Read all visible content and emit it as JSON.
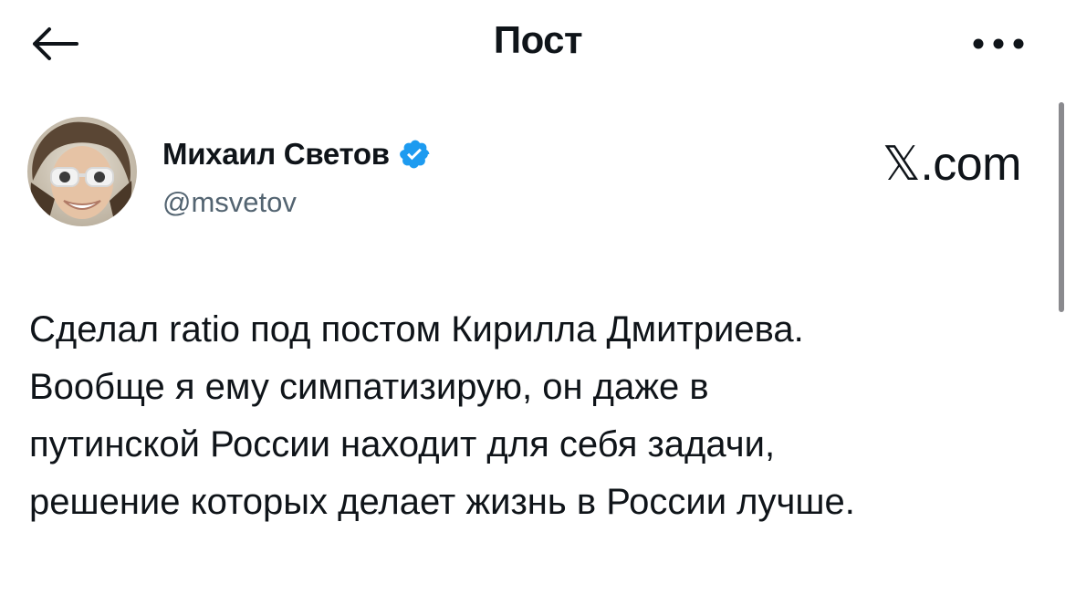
{
  "header": {
    "title": "Пост",
    "back_icon": "arrow-left-icon",
    "more_icon": "more-horizontal-icon"
  },
  "author": {
    "name": "Михаил Светов",
    "handle": "@msvetov",
    "verified": true,
    "verified_color": "#1d9bf0",
    "avatar_icon": "avatar-photo"
  },
  "source": {
    "logo_text": "𝕏.com"
  },
  "post": {
    "lines": [
      "Сделал ratio под постом Кирилла Дмитриева.",
      "Вообще я ему симпатизирую, он даже в",
      "путинской России находит для себя задачи,",
      "решение которых делает жизнь в России лучше."
    ]
  }
}
